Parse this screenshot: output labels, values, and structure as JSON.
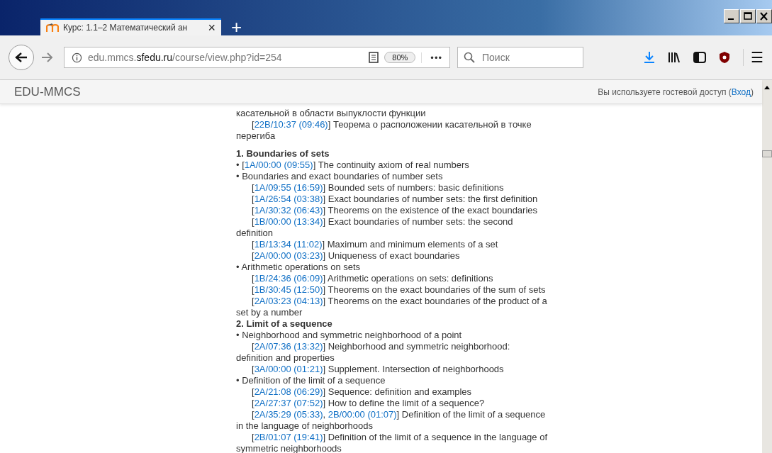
{
  "browser": {
    "tabs": [
      {
        "title": "Курс: 1.1–2 Математический ан",
        "close": "×",
        "selected": true
      }
    ],
    "new_tab": "+",
    "address": {
      "host_prefix": "edu.mmcs.",
      "domain": "sfedu.ru",
      "path": "/course/view.php?id=254"
    },
    "zoom": "80%",
    "more": "•••",
    "search": {
      "placeholder": "Поиск"
    },
    "menu": "☰"
  },
  "site": {
    "brand": "EDU-MMCS",
    "login_note": [
      {
        "kind": "plain",
        "text": "Вы используете гостевой доступ ("
      },
      {
        "kind": "link",
        "text": "Вход"
      },
      {
        "kind": "plain",
        "text": ")"
      }
    ]
  },
  "content": [
    {
      "kind": "continuation",
      "parts": [
        {
          "kind": "plain",
          "text": "касательной в области выпуклости функции"
        }
      ]
    },
    {
      "kind": "entry",
      "parts": [
        {
          "kind": "plain",
          "text": "["
        },
        {
          "kind": "link",
          "text": "22B/10:37 (09:46)"
        },
        {
          "kind": "plain",
          "text": "] Теорема о расположении касательной в точке перегиба"
        }
      ]
    },
    {
      "kind": "heading",
      "parts": [
        {
          "kind": "plain",
          "text": "1. Boundaries of sets"
        }
      ]
    },
    {
      "kind": "bullet",
      "parts": [
        {
          "kind": "plain",
          "text": "• ["
        },
        {
          "kind": "link",
          "text": "1A/00:00 (09:55)"
        },
        {
          "kind": "plain",
          "text": "] The continuity axiom of real numbers"
        }
      ]
    },
    {
      "kind": "bullet",
      "parts": [
        {
          "kind": "plain",
          "text": "• Boundaries and exact boundaries of number sets"
        }
      ]
    },
    {
      "kind": "entry",
      "parts": [
        {
          "kind": "plain",
          "text": "["
        },
        {
          "kind": "link",
          "text": "1A/09:55 (16:59)"
        },
        {
          "kind": "plain",
          "text": "] Bounded sets of numbers: basic definitions"
        }
      ]
    },
    {
      "kind": "entry",
      "parts": [
        {
          "kind": "plain",
          "text": "["
        },
        {
          "kind": "link",
          "text": "1A/26:54 (03:38)"
        },
        {
          "kind": "plain",
          "text": "] Exact boundaries of number sets: the first definition"
        }
      ]
    },
    {
      "kind": "entry",
      "parts": [
        {
          "kind": "plain",
          "text": "["
        },
        {
          "kind": "link",
          "text": "1A/30:32 (06:43)"
        },
        {
          "kind": "plain",
          "text": "] Theorems on the existence of the exact boundaries"
        }
      ]
    },
    {
      "kind": "entry",
      "parts": [
        {
          "kind": "plain",
          "text": "["
        },
        {
          "kind": "link",
          "text": "1B/00:00 (13:34)"
        },
        {
          "kind": "plain",
          "text": "] Exact boundaries of number sets: the second definition"
        }
      ]
    },
    {
      "kind": "entry",
      "parts": [
        {
          "kind": "plain",
          "text": "["
        },
        {
          "kind": "link",
          "text": "1B/13:34 (11:02)"
        },
        {
          "kind": "plain",
          "text": "] Maximum and minimum elements of a set"
        }
      ]
    },
    {
      "kind": "entry",
      "parts": [
        {
          "kind": "plain",
          "text": "["
        },
        {
          "kind": "link",
          "text": "2A/00:00 (03:23)"
        },
        {
          "kind": "plain",
          "text": "] Uniqueness of exact boundaries"
        }
      ]
    },
    {
      "kind": "bullet",
      "parts": [
        {
          "kind": "plain",
          "text": "• Arithmetic operations on sets"
        }
      ]
    },
    {
      "kind": "entry",
      "parts": [
        {
          "kind": "plain",
          "text": "["
        },
        {
          "kind": "link",
          "text": "1B/24:36 (06:09)"
        },
        {
          "kind": "plain",
          "text": "] Arithmetic operations on sets: definitions"
        }
      ]
    },
    {
      "kind": "entry",
      "parts": [
        {
          "kind": "plain",
          "text": "["
        },
        {
          "kind": "link",
          "text": "1B/30:45 (12:50)"
        },
        {
          "kind": "plain",
          "text": "] Theorems on the exact boundaries of the sum of sets"
        }
      ]
    },
    {
      "kind": "entry",
      "parts": [
        {
          "kind": "plain",
          "text": "["
        },
        {
          "kind": "link",
          "text": "2A/03:23 (04:13)"
        },
        {
          "kind": "plain",
          "text": "] Theorems on the exact boundaries of the product of a set by a number"
        }
      ]
    },
    {
      "kind": "subheading",
      "parts": [
        {
          "kind": "plain",
          "text": "2. Limit of a sequence"
        }
      ]
    },
    {
      "kind": "bullet",
      "parts": [
        {
          "kind": "plain",
          "text": "• Neighborhood and symmetric neighborhood of a point"
        }
      ]
    },
    {
      "kind": "entry",
      "parts": [
        {
          "kind": "plain",
          "text": "["
        },
        {
          "kind": "link",
          "text": "2A/07:36 (13:32)"
        },
        {
          "kind": "plain",
          "text": "] Neighborhood and symmetric neighborhood: definition and properties"
        }
      ]
    },
    {
      "kind": "entry",
      "parts": [
        {
          "kind": "plain",
          "text": "["
        },
        {
          "kind": "link",
          "text": "3A/00:00 (01:21)"
        },
        {
          "kind": "plain",
          "text": "] Supplement. Intersection of neighborhoods"
        }
      ]
    },
    {
      "kind": "bullet",
      "parts": [
        {
          "kind": "plain",
          "text": "• Definition of the limit of a sequence"
        }
      ]
    },
    {
      "kind": "entry",
      "parts": [
        {
          "kind": "plain",
          "text": "["
        },
        {
          "kind": "link",
          "text": "2A/21:08 (06:29)"
        },
        {
          "kind": "plain",
          "text": "] Sequence: definition and examples"
        }
      ]
    },
    {
      "kind": "entry",
      "parts": [
        {
          "kind": "plain",
          "text": "["
        },
        {
          "kind": "link",
          "text": "2A/27:37 (07:52)"
        },
        {
          "kind": "plain",
          "text": "] How to define the limit of a sequence?"
        }
      ]
    },
    {
      "kind": "entry",
      "parts": [
        {
          "kind": "plain",
          "text": "["
        },
        {
          "kind": "link",
          "text": "2A/35:29 (05:33)"
        },
        {
          "kind": "plain",
          "text": ", "
        },
        {
          "kind": "link",
          "text": "2B/00:00 (01:07)"
        },
        {
          "kind": "plain",
          "text": "] Definition of the limit of a sequence in the language of neighborhoods"
        }
      ]
    },
    {
      "kind": "entry",
      "parts": [
        {
          "kind": "plain",
          "text": "["
        },
        {
          "kind": "link",
          "text": "2B/01:07 (19:41)"
        },
        {
          "kind": "plain",
          "text": "] Definition of the limit of a sequence in the language of symmetric neighborhoods"
        }
      ]
    }
  ]
}
